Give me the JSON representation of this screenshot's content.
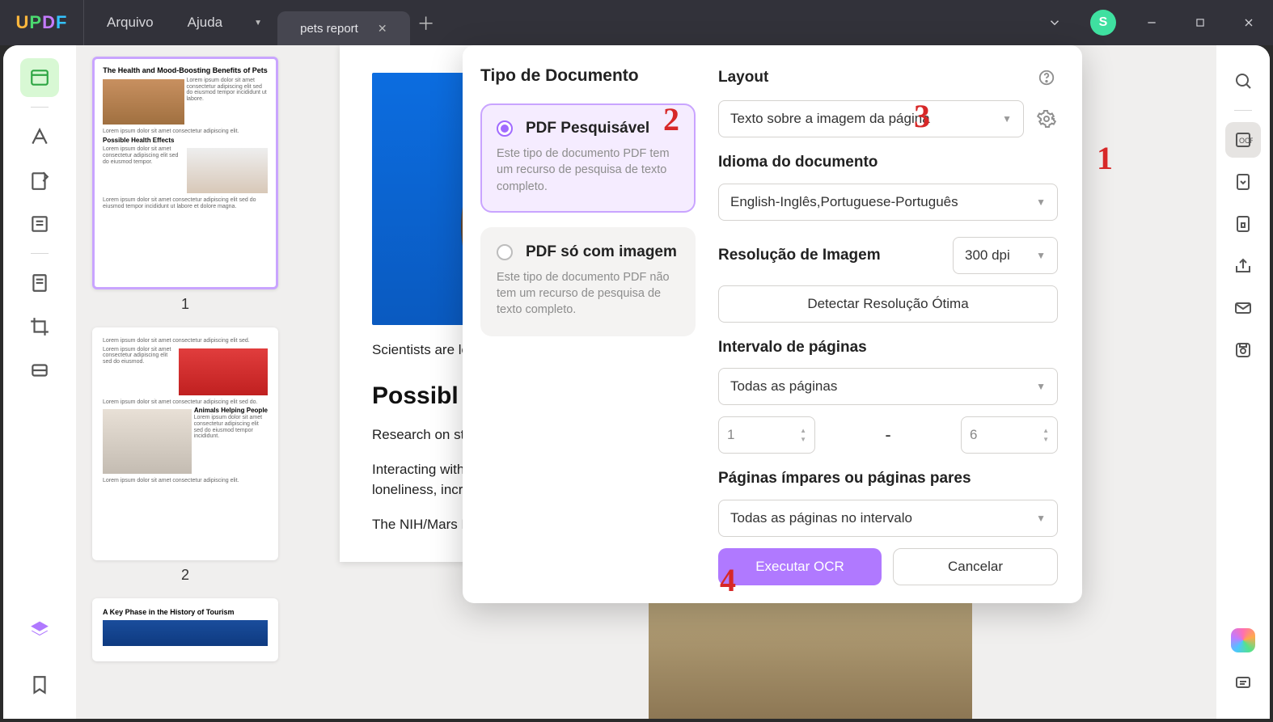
{
  "menu": {
    "file": "Arquivo",
    "help": "Ajuda"
  },
  "tab": {
    "title": "pets report"
  },
  "avatar": "S",
  "thumbs": {
    "p1_title": "The Health and Mood-Boosting Benefits of Pets",
    "p1_sub": "Possible Health Effects",
    "p2_sub": "Animals Helping People",
    "p3_title": "A Key Phase in the History of Tourism",
    "label1": "1",
    "label2": "2"
  },
  "doc": {
    "p1": "Scientists are looking at what the potential animals—from",
    "h1": "Possibl",
    "p2": "Research on still relatively shown positive results have",
    "p3": "Interacting with decrease levels hormone) and studies have",
    "p4": "loneliness, increase feelings of social support, and boost your mood.",
    "p5": "The NIH/Mars Partnership is funding a"
  },
  "ocr": {
    "doc_type": "Tipo de Documento",
    "opt1_label": "PDF Pesquisável",
    "opt1_desc": "Este tipo de documento PDF tem um recurso de pesquisa de texto completo.",
    "opt2_label": "PDF só com imagem",
    "opt2_desc": "Este tipo de documento PDF não tem um recurso de pesquisa de texto completo.",
    "layout": "Layout",
    "layout_value": "Texto sobre a imagem da página",
    "lang": "Idioma do documento",
    "lang_value": "English-Inglês,Portuguese-Português",
    "res": "Resolução de Imagem",
    "dpi": "300 dpi",
    "detect": "Detectar Resolução Ótima",
    "range": "Intervalo de páginas",
    "range_value": "Todas as páginas",
    "from": "1",
    "to": "6",
    "dash": "-",
    "odd_even": "Páginas ímpares ou páginas pares",
    "odd_even_value": "Todas as páginas no intervalo",
    "run": "Executar OCR",
    "cancel": "Cancelar"
  },
  "anno": {
    "n1": "1",
    "n2": "2",
    "n3": "3",
    "n4": "4"
  }
}
